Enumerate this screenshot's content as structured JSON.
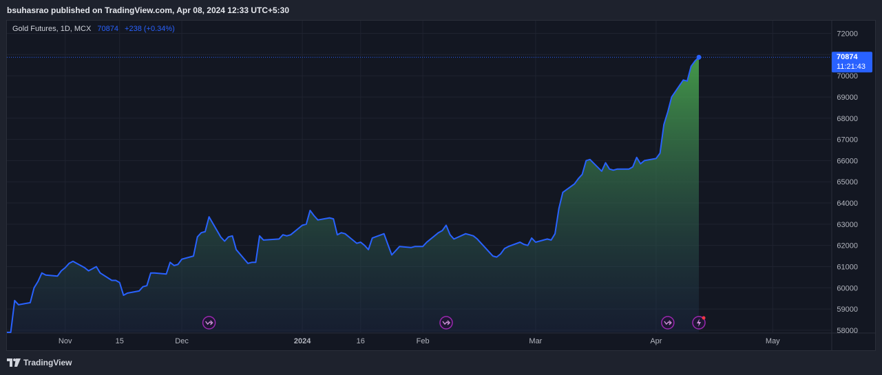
{
  "header": {
    "published_text": "bsuhasrao published on TradingView.com, Apr 08, 2024 12:33 UTC+5:30"
  },
  "legend": {
    "symbol": "Gold Futures, 1D, MCX",
    "last": "70874",
    "change": "+238 (+0.34%)"
  },
  "price_label": {
    "value": "70874",
    "countdown": "11:21:43"
  },
  "footer": {
    "brand": "TradingView"
  },
  "colors": {
    "line": "#2962ff",
    "area_top": "#4caf50",
    "area_bottom": "#1c2a4a",
    "grid": "#1f2330",
    "price_tag": "#2962ff",
    "event_icon": "#9c27b0",
    "alert_dot": "#f23645"
  },
  "chart_data": {
    "type": "area",
    "title": "",
    "xlabel": "",
    "ylabel": "",
    "ylim": [
      57900,
      72600
    ],
    "y_ticks": [
      "72000",
      "71000",
      "70000",
      "69000",
      "68000",
      "67000",
      "66000",
      "65000",
      "64000",
      "63000",
      "62000",
      "61000",
      "60000",
      "59000",
      "58000"
    ],
    "x_ticks": [
      {
        "label": "Nov",
        "x": "2023-11-01"
      },
      {
        "label": "15",
        "x": "2023-11-15"
      },
      {
        "label": "Dec",
        "x": "2023-12-01"
      },
      {
        "label": "2024",
        "x": "2024-01-01"
      },
      {
        "label": "16",
        "x": "2024-01-16"
      },
      {
        "label": "Feb",
        "x": "2024-02-01"
      },
      {
        "label": "Mar",
        "x": "2024-03-01"
      },
      {
        "label": "Apr",
        "x": "2024-04-01"
      },
      {
        "label": "May",
        "x": "2024-05-01"
      }
    ],
    "xlim": [
      "2023-10-17",
      "2024-05-16"
    ],
    "series": [
      {
        "values": [
          [
            "2023-10-17",
            57900
          ],
          [
            "2023-10-18",
            57900
          ],
          [
            "2023-10-19",
            59400
          ],
          [
            "2023-10-20",
            59200
          ],
          [
            "2023-10-23",
            59300
          ],
          [
            "2023-10-24",
            60000
          ],
          [
            "2023-10-25",
            60300
          ],
          [
            "2023-10-26",
            60700
          ],
          [
            "2023-10-27",
            60600
          ],
          [
            "2023-10-30",
            60550
          ],
          [
            "2023-10-31",
            60800
          ],
          [
            "2023-11-01",
            60950
          ],
          [
            "2023-11-02",
            61150
          ],
          [
            "2023-11-03",
            61250
          ],
          [
            "2023-11-06",
            60950
          ],
          [
            "2023-11-07",
            60800
          ],
          [
            "2023-11-08",
            60900
          ],
          [
            "2023-11-09",
            61000
          ],
          [
            "2023-11-10",
            60700
          ],
          [
            "2023-11-13",
            60350
          ],
          [
            "2023-11-14",
            60350
          ],
          [
            "2023-11-15",
            60250
          ],
          [
            "2023-11-16",
            59650
          ],
          [
            "2023-11-17",
            59750
          ],
          [
            "2023-11-20",
            59850
          ],
          [
            "2023-11-21",
            60050
          ],
          [
            "2023-11-22",
            60100
          ],
          [
            "2023-11-23",
            60700
          ],
          [
            "2023-11-24",
            60700
          ],
          [
            "2023-11-27",
            60650
          ],
          [
            "2023-11-28",
            61200
          ],
          [
            "2023-11-29",
            61050
          ],
          [
            "2023-11-30",
            61100
          ],
          [
            "2023-12-01",
            61350
          ],
          [
            "2023-12-04",
            61500
          ],
          [
            "2023-12-05",
            62400
          ],
          [
            "2023-12-06",
            62600
          ],
          [
            "2023-12-07",
            62650
          ],
          [
            "2023-12-08",
            63350
          ],
          [
            "2023-12-11",
            62400
          ],
          [
            "2023-12-12",
            62200
          ],
          [
            "2023-12-13",
            62400
          ],
          [
            "2023-12-14",
            62450
          ],
          [
            "2023-12-15",
            61800
          ],
          [
            "2023-12-18",
            61150
          ],
          [
            "2023-12-19",
            61200
          ],
          [
            "2023-12-20",
            61200
          ],
          [
            "2023-12-21",
            62450
          ],
          [
            "2023-12-22",
            62250
          ],
          [
            "2023-12-26",
            62300
          ],
          [
            "2023-12-27",
            62500
          ],
          [
            "2023-12-28",
            62450
          ],
          [
            "2023-12-29",
            62500
          ],
          [
            "2024-01-01",
            62950
          ],
          [
            "2024-01-02",
            63000
          ],
          [
            "2024-01-03",
            63650
          ],
          [
            "2024-01-04",
            63400
          ],
          [
            "2024-01-05",
            63200
          ],
          [
            "2024-01-08",
            63300
          ],
          [
            "2024-01-09",
            63250
          ],
          [
            "2024-01-10",
            62500
          ],
          [
            "2024-01-11",
            62600
          ],
          [
            "2024-01-12",
            62550
          ],
          [
            "2024-01-15",
            62100
          ],
          [
            "2024-01-16",
            62150
          ],
          [
            "2024-01-17",
            62000
          ],
          [
            "2024-01-18",
            61800
          ],
          [
            "2024-01-19",
            62350
          ],
          [
            "2024-01-22",
            62550
          ],
          [
            "2024-01-23",
            62050
          ],
          [
            "2024-01-24",
            61550
          ],
          [
            "2024-01-25",
            61750
          ],
          [
            "2024-01-26",
            61950
          ],
          [
            "2024-01-29",
            61900
          ],
          [
            "2024-01-30",
            61950
          ],
          [
            "2024-01-31",
            61950
          ],
          [
            "2024-02-01",
            61950
          ],
          [
            "2024-02-02",
            62150
          ],
          [
            "2024-02-05",
            62600
          ],
          [
            "2024-02-06",
            62700
          ],
          [
            "2024-02-07",
            62950
          ],
          [
            "2024-02-08",
            62500
          ],
          [
            "2024-02-09",
            62300
          ],
          [
            "2024-02-12",
            62550
          ],
          [
            "2024-02-13",
            62500
          ],
          [
            "2024-02-14",
            62450
          ],
          [
            "2024-02-15",
            62300
          ],
          [
            "2024-02-16",
            62100
          ],
          [
            "2024-02-19",
            61500
          ],
          [
            "2024-02-20",
            61450
          ],
          [
            "2024-02-21",
            61600
          ],
          [
            "2024-02-22",
            61850
          ],
          [
            "2024-02-23",
            61950
          ],
          [
            "2024-02-26",
            62150
          ],
          [
            "2024-02-27",
            62050
          ],
          [
            "2024-02-28",
            62000
          ],
          [
            "2024-02-29",
            62350
          ],
          [
            "2024-03-01",
            62150
          ],
          [
            "2024-03-04",
            62300
          ],
          [
            "2024-03-05",
            62250
          ],
          [
            "2024-03-06",
            62550
          ],
          [
            "2024-03-07",
            63750
          ],
          [
            "2024-03-08",
            64500
          ],
          [
            "2024-03-11",
            64900
          ],
          [
            "2024-03-12",
            65150
          ],
          [
            "2024-03-13",
            65350
          ],
          [
            "2024-03-14",
            66000
          ],
          [
            "2024-03-15",
            66050
          ],
          [
            "2024-03-18",
            65500
          ],
          [
            "2024-03-19",
            65900
          ],
          [
            "2024-03-20",
            65600
          ],
          [
            "2024-03-21",
            65550
          ],
          [
            "2024-03-22",
            65600
          ],
          [
            "2024-03-25",
            65600
          ],
          [
            "2024-03-26",
            65700
          ],
          [
            "2024-03-27",
            66150
          ],
          [
            "2024-03-28",
            65850
          ],
          [
            "2024-03-29",
            66000
          ],
          [
            "2024-04-01",
            66100
          ],
          [
            "2024-04-02",
            66350
          ],
          [
            "2024-04-03",
            67700
          ],
          [
            "2024-04-04",
            68300
          ],
          [
            "2024-04-05",
            69000
          ],
          [
            "2024-04-08",
            69800
          ],
          [
            "2024-04-09",
            69750
          ],
          [
            "2024-04-10",
            70450
          ],
          [
            "2024-04-11",
            70700
          ],
          [
            "2024-04-12",
            70874
          ]
        ]
      }
    ],
    "last_value": 70874,
    "markers": [
      {
        "type": "dividend-forward",
        "x": "2023-12-08"
      },
      {
        "type": "dividend-forward",
        "x": "2024-02-07"
      },
      {
        "type": "dividend-forward",
        "x": "2024-04-04"
      },
      {
        "type": "lightning",
        "x": "2024-04-12"
      }
    ],
    "grid": true,
    "legend": "none"
  }
}
